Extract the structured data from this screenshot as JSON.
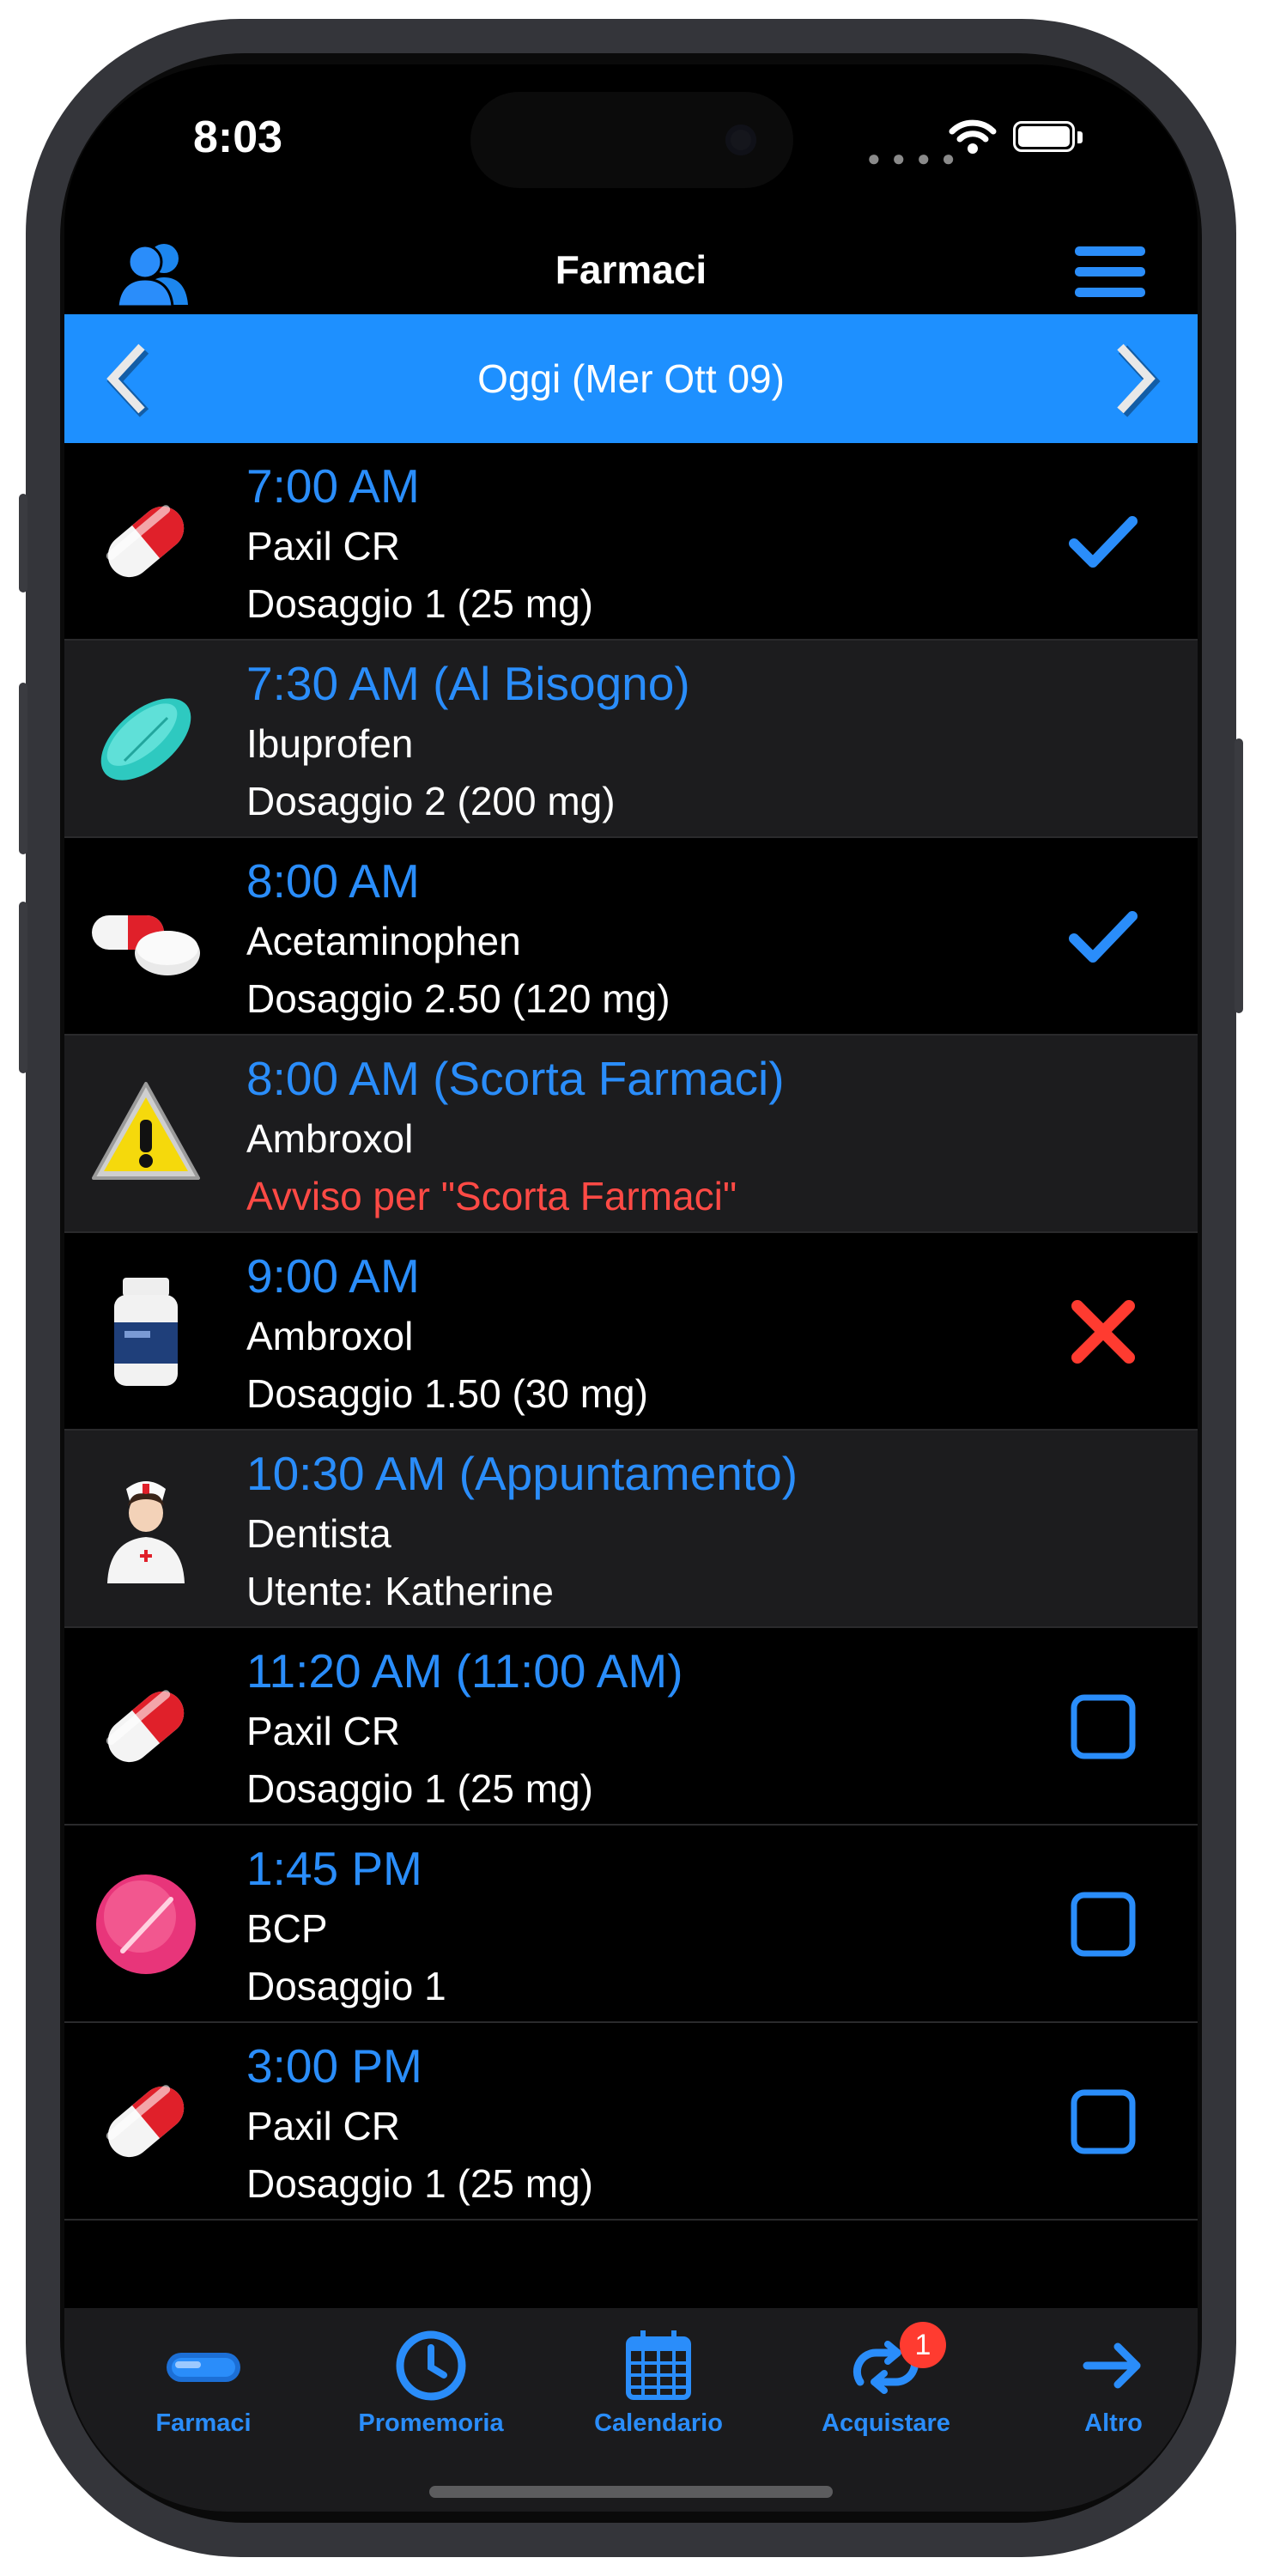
{
  "status_bar": {
    "time": "8:03"
  },
  "header": {
    "title": "Farmaci"
  },
  "date_bar": {
    "label": "Oggi (Mer Ott 09)"
  },
  "items": [
    {
      "time": "7:00 AM",
      "name": "Paxil CR",
      "detail": "Dosaggio 1 (25 mg)",
      "icon": "capsule-icon",
      "status": "taken"
    },
    {
      "time": "7:30 AM (Al Bisogno)",
      "name": "Ibuprofen",
      "detail": "Dosaggio 2 (200 mg)",
      "icon": "tablet-icon",
      "status": "none"
    },
    {
      "time": "8:00 AM",
      "name": "Acetaminophen",
      "detail": "Dosaggio 2.50 (120 mg)",
      "icon": "pills-icon",
      "status": "taken"
    },
    {
      "time": "8:00 AM (Scorta Farmaci)",
      "name": "Ambroxol",
      "detail": "Avviso per \"Scorta Farmaci\"",
      "icon": "warning-icon",
      "status": "none"
    },
    {
      "time": "9:00 AM",
      "name": "Ambroxol",
      "detail": "Dosaggio 1.50 (30 mg)",
      "icon": "bottle-icon",
      "status": "skipped"
    },
    {
      "time": "10:30 AM (Appuntamento)",
      "name": "Dentista",
      "detail": "Utente: Katherine",
      "icon": "nurse-icon",
      "status": "none"
    },
    {
      "time": "11:20 AM (11:00 AM)",
      "name": "Paxil CR",
      "detail": "Dosaggio 1 (25 mg)",
      "icon": "capsule-icon",
      "status": "pending"
    },
    {
      "time": "1:45 PM",
      "name": "BCP",
      "detail": "Dosaggio 1",
      "icon": "pink-pill-icon",
      "status": "pending"
    },
    {
      "time": "3:00 PM",
      "name": "Paxil CR",
      "detail": "Dosaggio 1 (25 mg)",
      "icon": "capsule-icon",
      "status": "pending"
    }
  ],
  "tabs": [
    {
      "label": "Farmaci",
      "icon": "pill-tab-icon"
    },
    {
      "label": "Promemoria",
      "icon": "clock-icon"
    },
    {
      "label": "Calendario",
      "icon": "calendar-icon"
    },
    {
      "label": "Acquistare",
      "icon": "refill-icon",
      "badge": "1"
    },
    {
      "label": "Altro",
      "icon": "arrow-right-icon"
    }
  ],
  "colors": {
    "accent": "#2a8dfa",
    "date_bar": "#1e90ff",
    "warning_text": "#ff4a45",
    "skip": "#ff3b30"
  }
}
